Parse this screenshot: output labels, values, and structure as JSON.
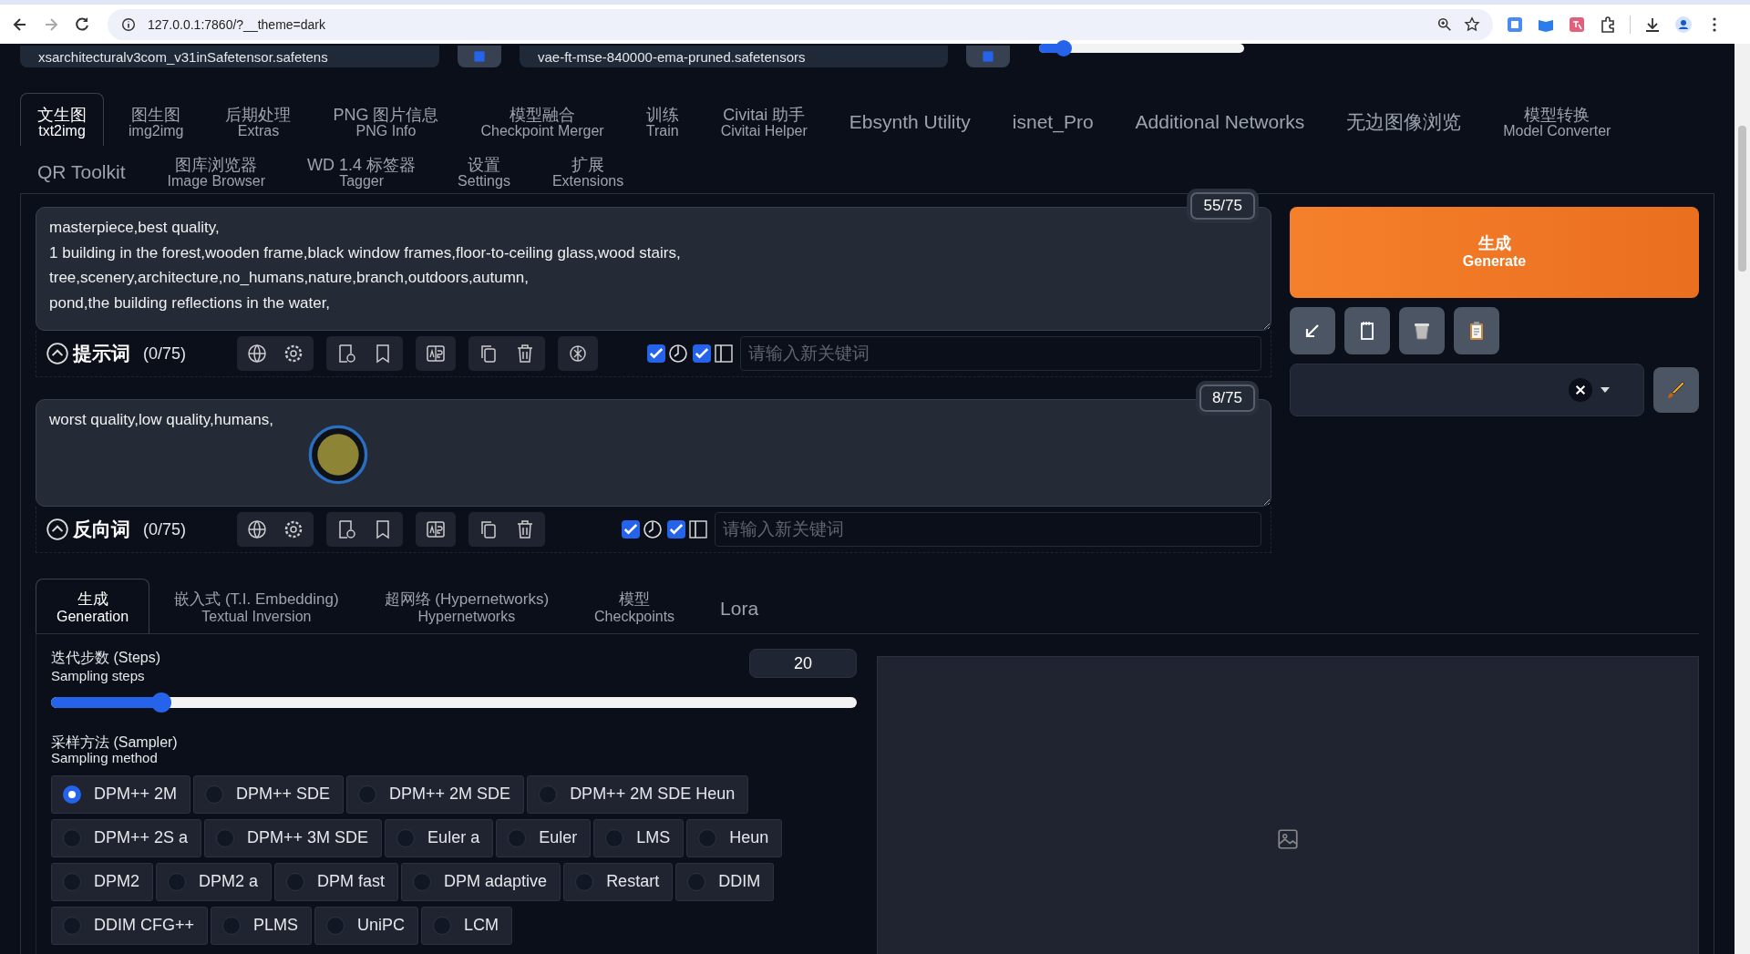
{
  "browser": {
    "url": "127.0.0.1:7860/?__theme=dark"
  },
  "models": [
    {
      "value": "xsarchitecturalv3com_v31inSafetensor.safetens"
    },
    {
      "value": "vae-ft-mse-840000-ema-pruned.safetensors"
    }
  ],
  "clip_skip": {
    "level": 0.12
  },
  "tab_rows": [
    [
      {
        "label": "文生图",
        "sublabel": "txt2img",
        "selected": true
      },
      {
        "label": "图生图",
        "sublabel": "img2img",
        "selected": false
      },
      {
        "label": "后期处理",
        "sublabel": "Extras",
        "selected": false
      },
      {
        "label": "PNG 图片信息",
        "sublabel": "PNG Info",
        "selected": false
      },
      {
        "label": "模型融合",
        "sublabel": "Checkpoint Merger",
        "selected": false
      },
      {
        "label": "训练",
        "sublabel": "Train",
        "selected": false
      },
      {
        "label": "Civitai 助手",
        "sublabel": "Civitai Helper",
        "selected": false
      },
      {
        "label": "Ebsynth Utility",
        "selected": false
      },
      {
        "label": "isnet_Pro",
        "selected": false
      },
      {
        "label": "Additional Networks",
        "selected": false
      },
      {
        "label": "无边图像浏览",
        "selected": false
      },
      {
        "label": "模型转换",
        "sublabel": "Model Converter",
        "selected": false
      }
    ],
    [
      {
        "label": "QR Toolkit",
        "selected": false
      },
      {
        "label": "图库浏览器",
        "sublabel": "Image Browser",
        "selected": false
      },
      {
        "label": "WD 1.4 标签器",
        "sublabel": "Tagger",
        "selected": false
      },
      {
        "label": "设置",
        "sublabel": "Settings",
        "selected": false
      },
      {
        "label": "扩展",
        "sublabel": "Extensions",
        "selected": false
      }
    ]
  ],
  "prompts": [
    {
      "text": "masterpiece,best quality,\n1 building in the forest,wooden frame,black window frames,floor-to-ceiling glass,wood stairs,\ntree,scenery,architecture,no_humans,nature,branch,outdoors,autumn,\npond,the building reflections in the water,",
      "counter": "55/75",
      "label": "提示词",
      "count": "(0/75)",
      "has_ai_button": true,
      "checks": [
        true,
        true
      ],
      "keyword_placeholder": "请输入新关键词"
    },
    {
      "text": "worst quality,low quality,humans,",
      "counter": "8/75",
      "label": "反向词",
      "count": "(0/75)",
      "has_ai_button": false,
      "checks": [
        true,
        true
      ],
      "keyword_placeholder": "请输入新关键词"
    }
  ],
  "generate": {
    "label": "生成",
    "sublabel": "Generate"
  },
  "sub_tabs": [
    {
      "label": "生成",
      "sublabel": "Generation",
      "selected": true
    },
    {
      "label": "嵌入式 (T.I. Embedding)",
      "sublabel": "Textual Inversion",
      "selected": false
    },
    {
      "label": "超网络 (Hypernetworks)",
      "sublabel": "Hypernetworks",
      "selected": false
    },
    {
      "label": "模型",
      "sublabel": "Checkpoints",
      "selected": false
    },
    {
      "label": "Lora",
      "selected": false
    }
  ],
  "steps": {
    "label": "迭代步数 (Steps)",
    "sublabel": "Sampling steps",
    "value": "20",
    "level": 0.137
  },
  "sampler": {
    "label": "采样方法 (Sampler)",
    "sublabel": "Sampling method",
    "rows": [
      [
        {
          "label": "DPM++ 2M",
          "selected": true
        },
        {
          "label": "DPM++ SDE",
          "selected": false
        },
        {
          "label": "DPM++ 2M SDE",
          "selected": false
        },
        {
          "label": "DPM++ 2M SDE Heun",
          "selected": false
        }
      ],
      [
        {
          "label": "DPM++ 2S a",
          "selected": false
        },
        {
          "label": "DPM++ 3M SDE",
          "selected": false
        },
        {
          "label": "Euler a",
          "selected": false
        },
        {
          "label": "Euler",
          "selected": false
        },
        {
          "label": "LMS",
          "selected": false
        },
        {
          "label": "Heun",
          "selected": false
        }
      ],
      [
        {
          "label": "DPM2",
          "selected": false
        },
        {
          "label": "DPM2 a",
          "selected": false
        },
        {
          "label": "DPM fast",
          "selected": false
        },
        {
          "label": "DPM adaptive",
          "selected": false
        },
        {
          "label": "Restart",
          "selected": false
        },
        {
          "label": "DDIM",
          "selected": false
        }
      ],
      [
        {
          "label": "DDIM CFG++",
          "selected": false
        },
        {
          "label": "PLMS",
          "selected": false
        },
        {
          "label": "UniPC",
          "selected": false
        },
        {
          "label": "LCM",
          "selected": false
        }
      ]
    ]
  }
}
